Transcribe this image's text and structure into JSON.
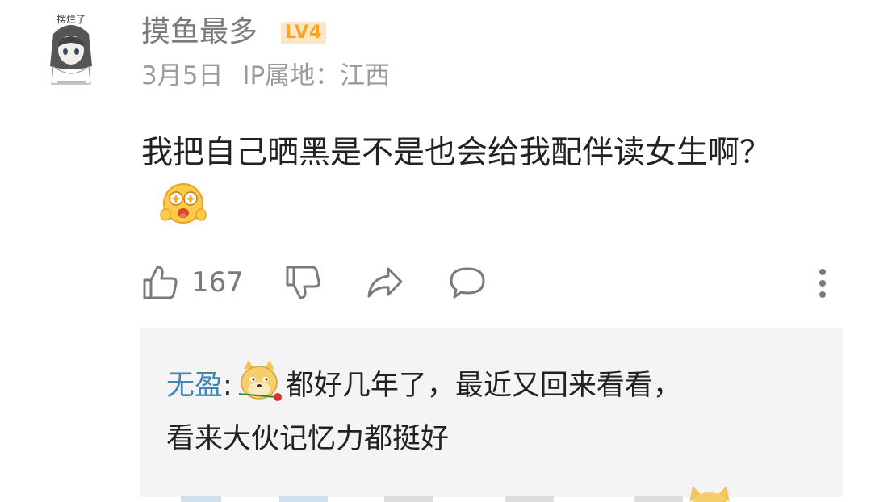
{
  "user": {
    "name": "摸鱼最多",
    "level": "LV4",
    "avatar_caption": "摆烂了",
    "date": "3月5日",
    "ip_location": "IP属地：江西"
  },
  "comment": {
    "text": "我把自己晒黑是不是也会给我配伴读女生啊？",
    "emoji": "star-eyed-emoji"
  },
  "actions": {
    "like_count": "167",
    "icons": [
      "thumbs-up-icon",
      "thumbs-down-icon",
      "share-icon",
      "comment-icon",
      "more-icon"
    ]
  },
  "reply": {
    "user": "无盈",
    "separator": ":",
    "line1": "都好几年了，最近又回来看看，",
    "line2": "看来大伙记忆力都挺好",
    "emoji": "doge-rose-emoji"
  },
  "colors": {
    "username": "#7a7a7a",
    "reply_user": "#3e86b5",
    "level_badge_bg": "#fde7c2",
    "level_badge_text": "#f5a623",
    "reply_bg": "#f4f4f4"
  }
}
